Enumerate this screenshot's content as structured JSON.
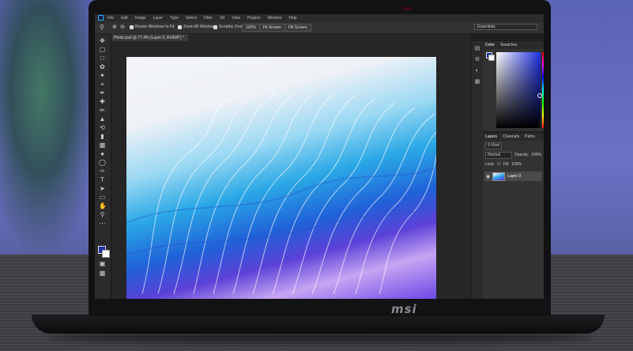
{
  "app": {
    "menus": [
      "File",
      "Edit",
      "Image",
      "Layer",
      "Type",
      "Select",
      "Filter",
      "3D",
      "View",
      "Plugins",
      "Window",
      "Help"
    ],
    "options_bar": {
      "resize_windows": "Resize Windows to Fit",
      "zoom_all_windows": "Zoom All Windows",
      "scrubby_zoom": "Scrubby Zoom",
      "zoom_value": "100%",
      "fit_screen": "Fit Screen",
      "fill_screen": "Fill Screen",
      "workspace": "Essentials"
    },
    "document_tab": "Photo.psd @ 77.4% (Layer 0, RGB/8*) *",
    "color_panel": {
      "tabs": [
        "Color",
        "Swatches"
      ],
      "foreground": "#1d2fa3",
      "background": "#ffffff"
    },
    "layers_panel": {
      "tabs": [
        "Layers",
        "Channels",
        "Paths"
      ],
      "filter": "Kind",
      "blend_mode": "Normal",
      "opacity_label": "Opacity:",
      "opacity_value": "100%",
      "lock_label": "Lock:",
      "fill_label": "Fill:",
      "fill_value": "100%",
      "layers": [
        {
          "name": "Layer 0",
          "visible": true
        }
      ]
    }
  },
  "device": {
    "brand": "msi"
  },
  "icons": [
    "move-tool-icon",
    "artboard-icon",
    "marquee-icon",
    "lasso-icon",
    "magic-wand-icon",
    "crop-icon",
    "eyedropper-icon",
    "healing-brush-icon",
    "brush-icon",
    "clone-stamp-icon",
    "history-brush-icon",
    "eraser-icon",
    "gradient-icon",
    "blur-icon",
    "dodge-icon",
    "pen-icon",
    "type-icon",
    "path-selection-icon",
    "rectangle-icon",
    "hand-icon",
    "zoom-icon",
    "more-tools-icon",
    "quick-mask-icon",
    "screen-mode-icon"
  ]
}
